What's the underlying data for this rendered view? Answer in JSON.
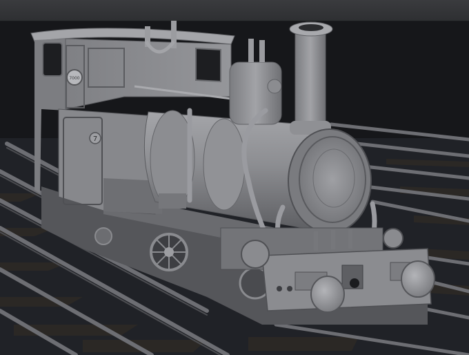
{
  "viewport": {
    "description_icon": "3d-render-viewport",
    "background_color": "#16171a",
    "toolbar_color": "#343538"
  },
  "scene": {
    "model_color": "#8e8f93",
    "rail_color": "#6f7075",
    "sleeper_color": "#2a2724",
    "ground_color": "#24262b"
  },
  "locomotive": {
    "cab_number": "7",
    "cab_badge_text": "7000"
  }
}
